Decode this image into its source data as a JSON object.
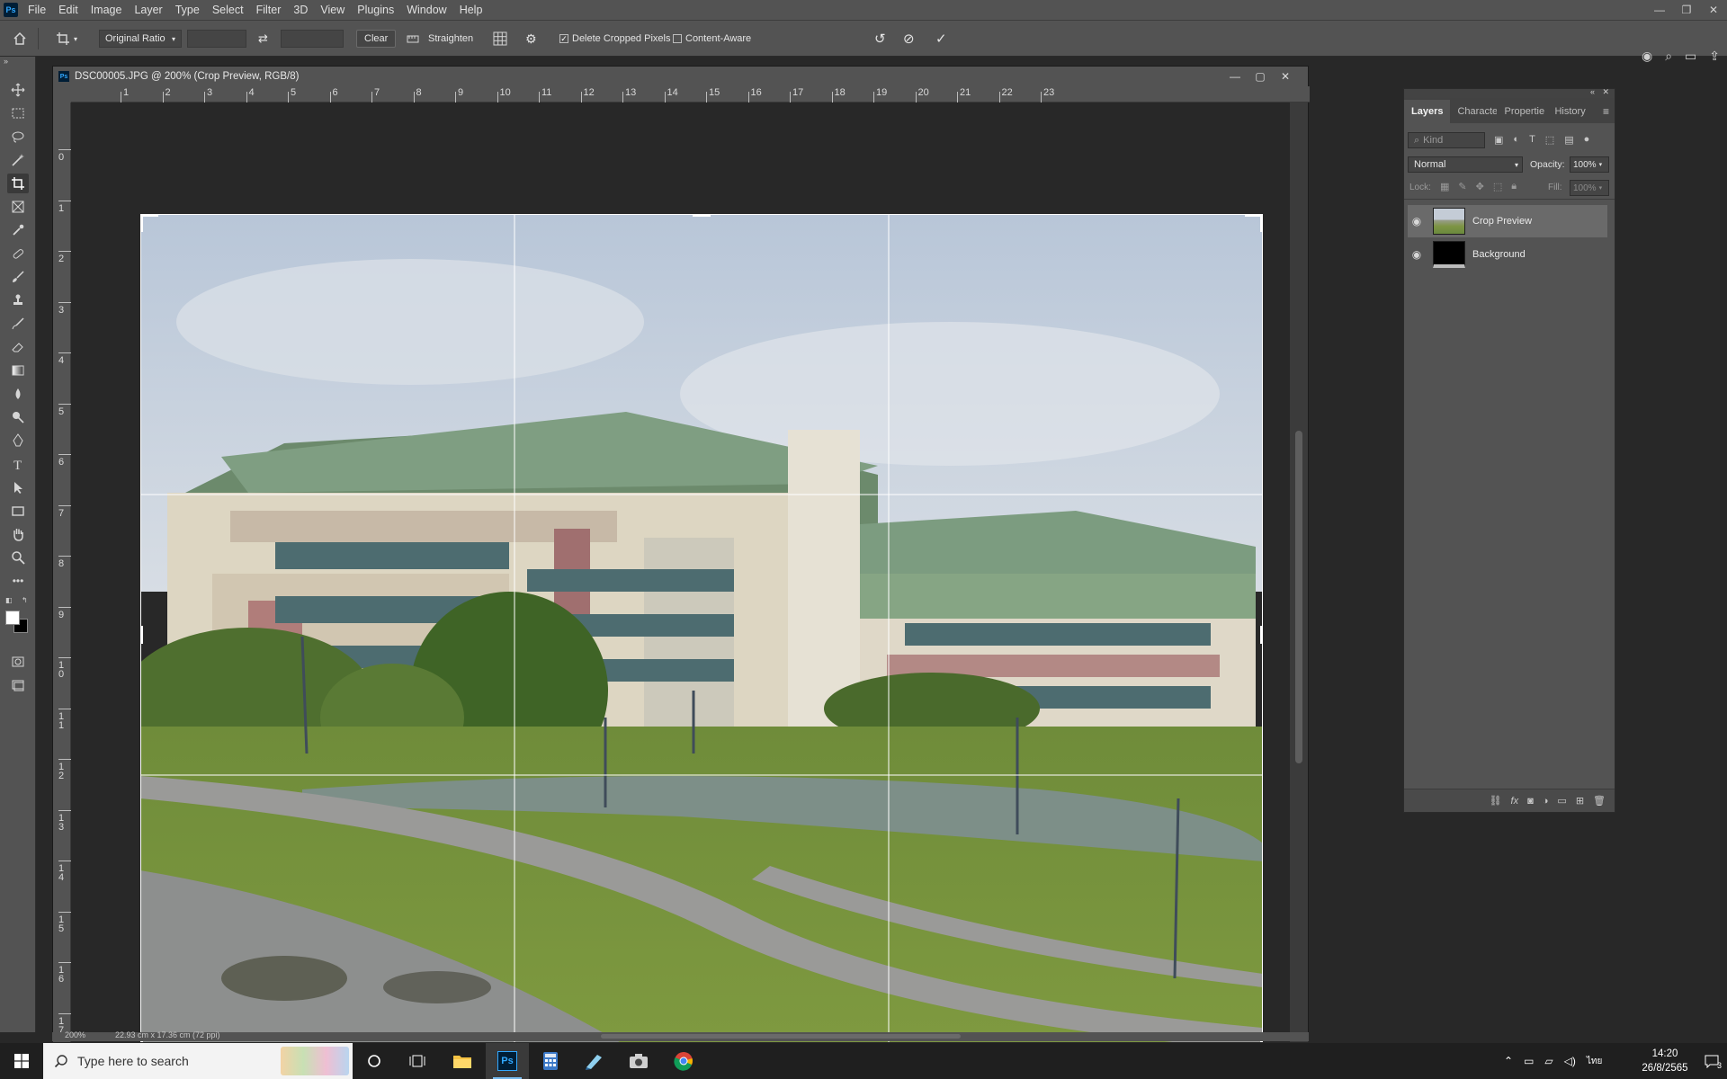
{
  "app": {
    "logo": "Ps",
    "menu": [
      "File",
      "Edit",
      "Image",
      "Layer",
      "Type",
      "Select",
      "Filter",
      "3D",
      "View",
      "Plugins",
      "Window",
      "Help"
    ]
  },
  "options_bar": {
    "ratio": "Original Ratio",
    "clear_label": "Clear",
    "straighten_label": "Straighten",
    "delete_cropped_label": "Delete Cropped Pixels",
    "delete_cropped_checked": true,
    "content_aware_label": "Content-Aware",
    "content_aware_checked": false
  },
  "document": {
    "title": "DSC00005.JPG @ 200% (Crop Preview, RGB/8)",
    "ruler_h": [
      "1",
      "2",
      "3",
      "4",
      "5",
      "6",
      "7",
      "8",
      "9",
      "10",
      "11",
      "12",
      "13",
      "14",
      "15",
      "16",
      "17",
      "18",
      "19",
      "20",
      "21",
      "22",
      "23"
    ],
    "ruler_v": [
      "0",
      "1",
      "2",
      "3",
      "4",
      "5",
      "6",
      "7",
      "8",
      "9",
      "10",
      "11",
      "12",
      "13",
      "14",
      "15",
      "16",
      "17"
    ],
    "status_zoom": "200%",
    "status_size": "22.93 cm x 17.36 cm (72 ppi)"
  },
  "layers_panel": {
    "tabs": [
      "Layers",
      "Characte",
      "Propertie",
      "History"
    ],
    "active_tab": "Layers",
    "filter_placeholder": "Kind",
    "blend_mode": "Normal",
    "opacity_label": "Opacity:",
    "opacity_value": "100%",
    "lock_label": "Lock:",
    "fill_label": "Fill:",
    "fill_value": "100%",
    "layers": [
      {
        "name": "Crop Preview",
        "visible": true,
        "selected": true
      },
      {
        "name": "Background",
        "visible": true,
        "selected": false
      }
    ]
  },
  "taskbar": {
    "search_placeholder": "Type here to search",
    "time": "14:20",
    "date": "26/8/2565",
    "notification_count": "3",
    "lang": "ไทย"
  },
  "colors": {
    "ui_panel": "#535353",
    "ui_dark": "#282828",
    "accent": "#31a8ff"
  }
}
